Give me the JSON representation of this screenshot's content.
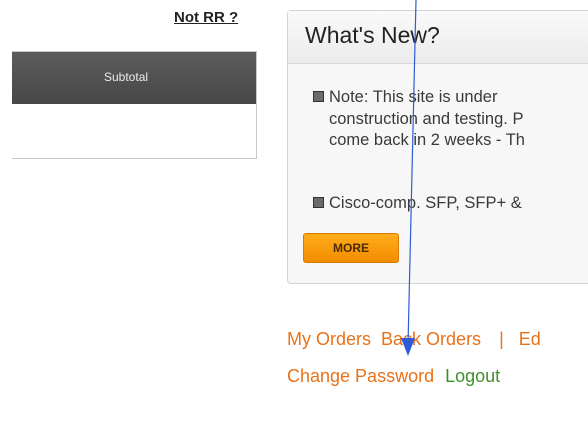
{
  "header": {
    "not_rr_link": "Not RR ?"
  },
  "cart": {
    "column_header": "Subtotal"
  },
  "whats_new": {
    "title": "What's New?",
    "items": [
      {
        "lines": [
          "Note: This site is under",
          "construction and testing. P",
          "come back in 2 weeks - Th"
        ]
      },
      {
        "lines": [
          "Cisco-comp. SFP, SFP+ &"
        ]
      }
    ],
    "more_label": "MORE"
  },
  "account_links": {
    "my_orders": "My Orders",
    "back_orders": "Back Orders",
    "separator": "|",
    "edit": "Ed",
    "change_password": "Change Password",
    "logout": "Logout"
  },
  "annotation": {
    "arrow_color": "#2e5cd6"
  }
}
